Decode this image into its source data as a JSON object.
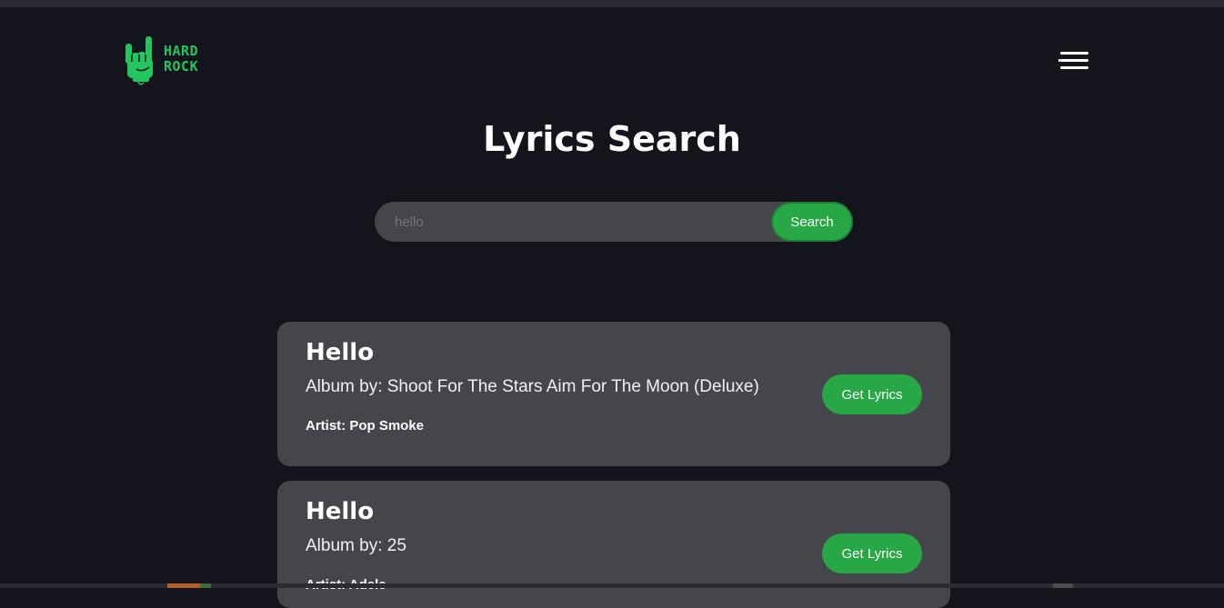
{
  "header": {
    "logo_line1": "HARD",
    "logo_line2": "ROCK",
    "menu_icon": "hamburger-menu-icon"
  },
  "main": {
    "title": "Lyrics Search",
    "search": {
      "value": "",
      "placeholder": "hello",
      "button_label": "Search"
    },
    "results": [
      {
        "title": "Hello",
        "album": "Album by: Shoot For The Stars Aim For The Moon (Deluxe)",
        "artist": "Artist: Pop Smoke",
        "button_label": "Get Lyrics"
      },
      {
        "title": "Hello",
        "album": "Album by: 25",
        "artist": "Artist: Adele",
        "button_label": "Get Lyrics"
      }
    ]
  },
  "colors": {
    "background": "#14141d",
    "card": "#45464c",
    "accent": "#27a745",
    "logo": "#22c55e"
  }
}
